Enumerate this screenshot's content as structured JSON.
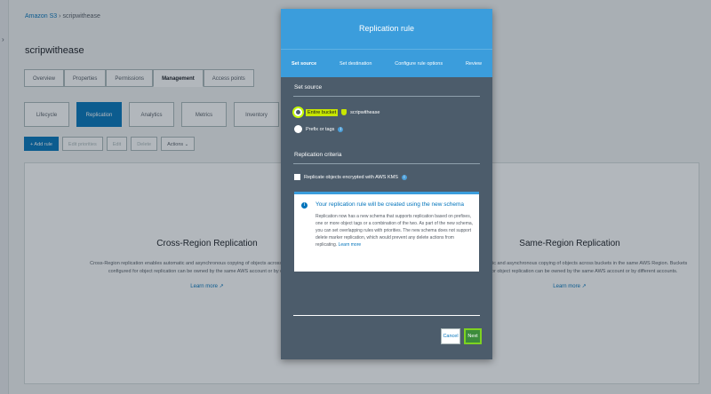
{
  "breadcrumb": {
    "root": "Amazon S3",
    "separator": "›",
    "bucket": "scripwithease"
  },
  "bucket_title": "scripwithease",
  "tabs": [
    "Overview",
    "Properties",
    "Permissions",
    "Management",
    "Access points"
  ],
  "subtabs": [
    "Lifecycle",
    "Replication",
    "Analytics",
    "Metrics",
    "Inventory"
  ],
  "toolbar": {
    "add_rule": "+ Add rule",
    "edit_priorities": "Edit priorities",
    "edit": "Edit",
    "delete": "Delete",
    "actions": "Actions ⌄"
  },
  "panel": {
    "left": {
      "title": "Cross-Region Replication",
      "desc": "Cross-Region replication enables automatic and asynchronous copying of objects across buckets in differe... configured for object replication can be owned by the same AWS account or by different a...",
      "more": "Learn more ↗"
    },
    "right": {
      "title": "Same-Region Replication",
      "desc": "...enables automatic and asynchronous copying of objects across buckets in the same AWS Region. Buckets ...configured for object replication can be owned by the same AWS account or by different accounts.",
      "more": "Learn more ↗"
    }
  },
  "modal": {
    "title": "Replication rule",
    "steps": [
      "Set source",
      "Set destination",
      "Configure rule options",
      "Review"
    ],
    "set_source_label": "Set source",
    "option_entire": "Entire bucket",
    "bucket_name": "scripwithease",
    "option_prefix": "Prefix or tags",
    "criteria_label": "Replication criteria",
    "kms_label": "Replicate objects encrypted with AWS KMS",
    "info": {
      "title": "Your replication rule will be created using the new schema",
      "body": "Replication now has a new schema that supports replication based on prefixes, one or more object tags or a combination of the two. As part of the new schema, you can set overlapping rules with priorities. The new schema does not support delete marker replication, which would prevent any delete actions from replicating.",
      "link": "Learn more"
    },
    "cancel": "Cancel",
    "next": "Next"
  }
}
